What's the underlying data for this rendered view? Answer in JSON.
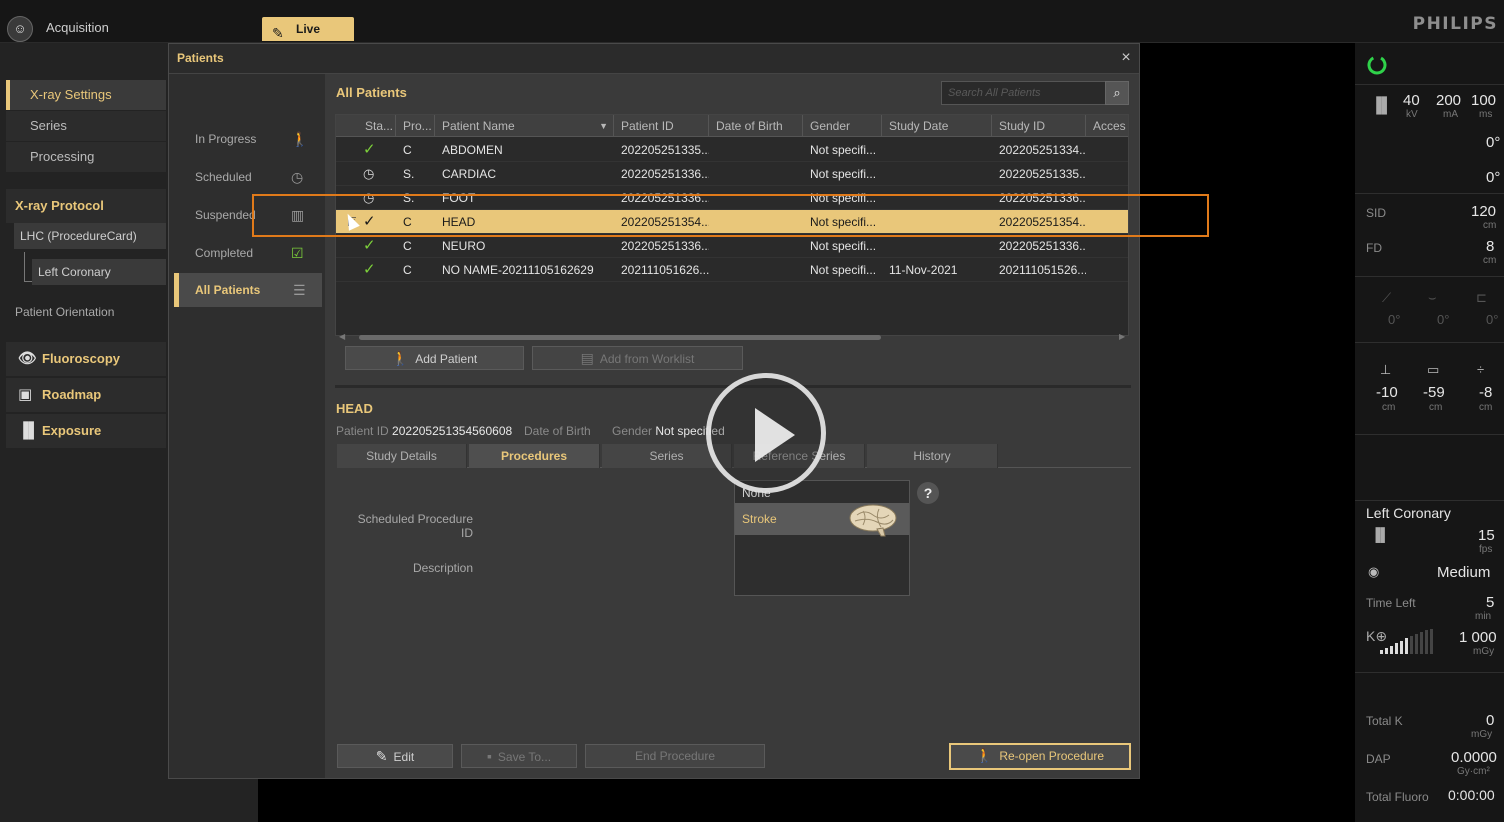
{
  "topbar": {
    "acquisition_label": "Acquisition",
    "live_tab_label": "Live",
    "brand": "PHILIPS"
  },
  "sidebar": {
    "xray_settings": "X-ray Settings",
    "series": "Series",
    "processing": "Processing",
    "xray_protocol": "X-ray Protocol",
    "procedure_card": "LHC (ProcedureCard)",
    "left_coronary": "Left Coronary",
    "patient_orientation": "Patient Orientation",
    "fluoroscopy": "Fluoroscopy",
    "roadmap": "Roadmap",
    "exposure": "Exposure"
  },
  "dialog": {
    "title": "Patients",
    "close_glyph": "×",
    "nav": [
      "In Progress",
      "Scheduled",
      "Suspended",
      "Completed",
      "All Patients"
    ],
    "section_title": "All Patients",
    "search_placeholder": "Search All Patients",
    "columns": [
      "Sta...",
      "Pro...",
      "Patient Name",
      "Patient ID",
      "Date of Birth",
      "Gender",
      "Study Date",
      "Study ID",
      "Acces"
    ],
    "rows": [
      {
        "status": "✓",
        "proc": "C",
        "name": "ABDOMEN",
        "pid": "202205251335...",
        "dob": "",
        "gender": "Not specifi...",
        "study_date": "",
        "study_id": "202205251334..."
      },
      {
        "status": "◷",
        "proc": "S.",
        "name": "CARDIAC",
        "pid": "202205251336...",
        "dob": "",
        "gender": "Not specifi...",
        "study_date": "",
        "study_id": "202205251335..."
      },
      {
        "status": "◷",
        "proc": "S.",
        "name": "FOOT",
        "pid": "202205251336...",
        "dob": "",
        "gender": "Not specifi...",
        "study_date": "",
        "study_id": "202205251336..."
      },
      {
        "status": "✓",
        "proc": "C",
        "name": "HEAD",
        "pid": "202205251354...",
        "dob": "",
        "gender": "Not specifi...",
        "study_date": "",
        "study_id": "202205251354..."
      },
      {
        "status": "✓",
        "proc": "C",
        "name": "NEURO",
        "pid": "202205251336...",
        "dob": "",
        "gender": "Not specifi...",
        "study_date": "",
        "study_id": "202205251336..."
      },
      {
        "status": "✓",
        "proc": "C",
        "name": "NO NAME-20211105162629",
        "pid": "202111051626...",
        "dob": "",
        "gender": "Not specifi...",
        "study_date": "11-Nov-2021",
        "study_id": "202111051526..."
      }
    ],
    "add_patient": "Add Patient",
    "add_from_worklist": "Add from Worklist",
    "detail": {
      "name": "HEAD",
      "patient_id_label": "Patient ID",
      "patient_id": "202205251354560608",
      "dob_label": "Date of Birth",
      "gender_label": "Gender",
      "gender": "Not specified"
    },
    "tabs": [
      "Study Details",
      "Procedures",
      "Series",
      "Reference Series",
      "History"
    ],
    "scheduled_procedure_id_label": "Scheduled Procedure ID",
    "description_label": "Description",
    "procedures": [
      "None",
      "Stroke"
    ],
    "help": "?",
    "edit": "Edit",
    "save_to": "Save To...",
    "end_procedure": "End Procedure",
    "reopen_procedure": "Re-open Procedure"
  },
  "right_panel": {
    "kv": "40",
    "kv_unit": "kV",
    "ma": "200",
    "ma_unit": "mA",
    "ms": "100",
    "ms_unit": "ms",
    "angle1": "0°",
    "angle2": "0°",
    "sid_label": "SID",
    "sid": "120",
    "sid_unit": "cm",
    "fd_label": "FD",
    "fd": "8",
    "fd_unit": "cm",
    "tilt1": "0°",
    "tilt2": "0°",
    "tilt3": "0°",
    "pos1": "-10",
    "pos2": "-59",
    "pos3": "-8",
    "pos_unit": "cm",
    "protocol": "Left Coronary",
    "fps": "15",
    "fps_unit": "fps",
    "dose_level": "Medium",
    "time_left_label": "Time Left",
    "time_left": "5",
    "time_unit": "min",
    "ke_label": "K⊕",
    "ke": "1 000",
    "ke_unit": "mGy",
    "total_k_label": "Total K",
    "total_k": "0",
    "total_k_unit": "mGy",
    "dap_label": "DAP",
    "dap": "0.0000",
    "dap_unit": "Gy·cm²",
    "total_fluoro_label": "Total Fluoro",
    "total_fluoro": "0:00:00"
  },
  "colors": {
    "accent": "#e9c77a",
    "highlight": "#e07a1a",
    "check": "#7ccf3a",
    "ring": "#2fd24a"
  }
}
